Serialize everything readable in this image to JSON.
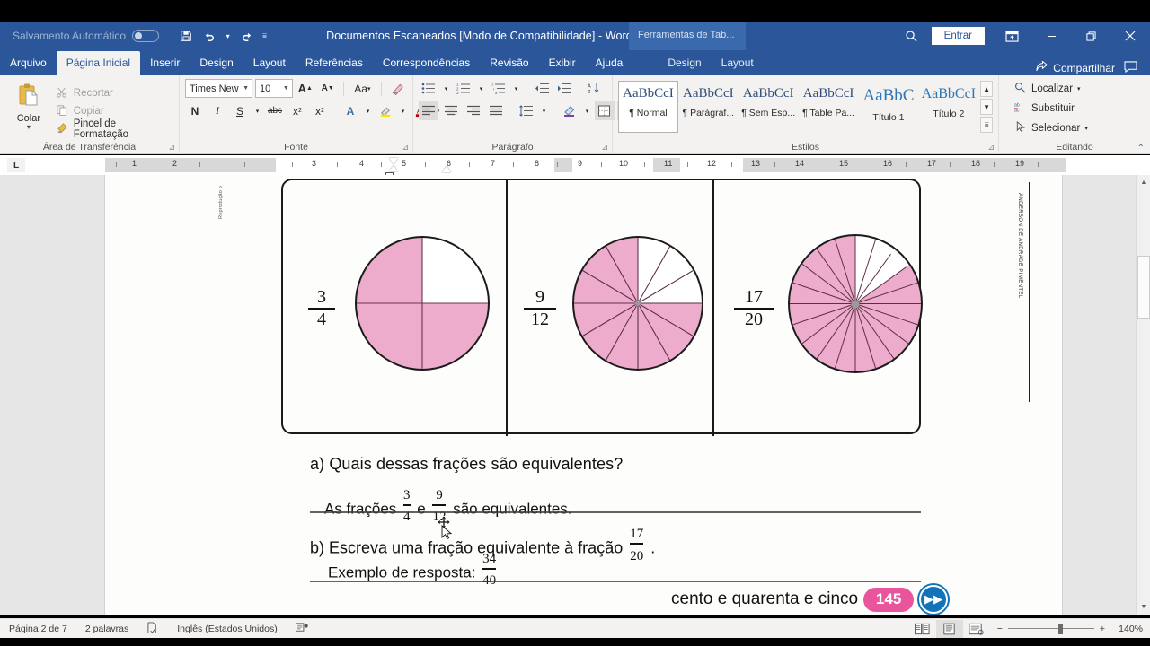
{
  "window": {
    "autosave_label": "Salvamento Automático",
    "doc_title": "Documentos Escaneados [Modo de Compatibilidade]  -  Word",
    "context_tools": "Ferramentas de Tab...",
    "sign_in": "Entrar",
    "share": "Compartilhar",
    "accent": "#2b579a"
  },
  "quick_access": [
    {
      "name": "save-icon",
      "glyph": "ὋE"
    },
    {
      "name": "undo-icon",
      "glyph": "↶"
    },
    {
      "name": "redo-icon",
      "glyph": "↷"
    },
    {
      "name": "customize-qat-icon",
      "glyph": "≡"
    }
  ],
  "tabs": [
    {
      "label": "Arquivo",
      "active": false
    },
    {
      "label": "Página Inicial",
      "active": true
    },
    {
      "label": "Inserir",
      "active": false
    },
    {
      "label": "Design",
      "active": false
    },
    {
      "label": "Layout",
      "active": false
    },
    {
      "label": "Referências",
      "active": false
    },
    {
      "label": "Correspondências",
      "active": false
    },
    {
      "label": "Revisão",
      "active": false
    },
    {
      "label": "Exibir",
      "active": false
    },
    {
      "label": "Ajuda",
      "active": false
    }
  ],
  "context_tabs": [
    {
      "label": "Design"
    },
    {
      "label": "Layout"
    }
  ],
  "ribbon": {
    "clipboard": {
      "group_name": "Área de Transferência",
      "paste_label": "Colar",
      "items": [
        {
          "label": "Recortar",
          "icon": "scissors-icon",
          "enabled": false
        },
        {
          "label": "Copiar",
          "icon": "copy-icon",
          "enabled": false
        },
        {
          "label": "Pincel de Formatação",
          "icon": "format-painter-icon",
          "enabled": true
        }
      ]
    },
    "font": {
      "group_name": "Fonte",
      "font_name": "Times New R",
      "font_size": "10",
      "buttons": [
        {
          "name": "grow-font",
          "glyph": "A"
        },
        {
          "name": "shrink-font",
          "glyph": "A"
        },
        {
          "name": "change-case",
          "glyph": "Aa"
        },
        {
          "name": "clear-formatting",
          "glyph": "⌫"
        },
        {
          "name": "bold",
          "glyph": "N"
        },
        {
          "name": "italic",
          "glyph": "I"
        },
        {
          "name": "underline",
          "glyph": "S"
        },
        {
          "name": "strikethrough",
          "glyph": "abc"
        },
        {
          "name": "subscript",
          "glyph": "x₂"
        },
        {
          "name": "superscript",
          "glyph": "x²"
        },
        {
          "name": "text-effects",
          "glyph": "A"
        },
        {
          "name": "text-highlight",
          "glyph": "ab"
        },
        {
          "name": "font-color",
          "glyph": "A"
        }
      ]
    },
    "paragraph": {
      "group_name": "Parágrafo"
    },
    "styles": {
      "group_name": "Estilos",
      "items": [
        {
          "preview": "AaBbCcI",
          "name": "¶ Normal",
          "selected": true,
          "size": "normal"
        },
        {
          "preview": "AaBbCcI",
          "name": "¶ Parágraf...",
          "selected": false,
          "size": "normal"
        },
        {
          "preview": "AaBbCcI",
          "name": "¶ Sem Esp...",
          "selected": false,
          "size": "normal"
        },
        {
          "preview": "AaBbCcI",
          "name": "¶ Table Pa...",
          "selected": false,
          "size": "normal"
        },
        {
          "preview": "AaBbC",
          "name": "Título 1",
          "selected": false,
          "size": "t1"
        },
        {
          "preview": "AaBbCcI",
          "name": "Título 2",
          "selected": false,
          "size": "t2"
        }
      ]
    },
    "editing": {
      "group_name": "Editando",
      "items": [
        {
          "label": "Localizar",
          "icon": "search-icon",
          "dropdown": true
        },
        {
          "label": "Substituir",
          "icon": "replace-icon",
          "dropdown": false
        },
        {
          "label": "Selecionar",
          "icon": "select-icon",
          "dropdown": true
        }
      ]
    }
  },
  "ruler": {
    "tab_stop_marker": "L",
    "numbers": [
      "1",
      "2",
      "3",
      "4",
      "5",
      "6",
      "7",
      "8",
      "9",
      "10",
      "11",
      "12",
      "13",
      "14",
      "15",
      "16",
      "17",
      "18",
      "19"
    ]
  },
  "document": {
    "vertical_left_credit": "Reprodução p",
    "vertical_right_credit": "ANDERSON DE ANDRADE PIMENTEL",
    "figures": [
      {
        "fraction_num": "3",
        "fraction_den": "4",
        "slices": 4,
        "shaded": 3
      },
      {
        "fraction_num": "9",
        "fraction_den": "12",
        "slices": 12,
        "shaded": 9
      },
      {
        "fraction_num": "17",
        "fraction_den": "20",
        "slices": 20,
        "shaded": 17
      }
    ],
    "question_a": {
      "marker": "a)",
      "text": "Quais dessas frações são equivalentes?",
      "answer_prefix": "As frações",
      "answer_frac1_num": "3",
      "answer_frac1_den": "4",
      "answer_conj": "e",
      "answer_frac2_num": "9",
      "answer_frac2_den": "12",
      "answer_suffix": "são equivalentes."
    },
    "question_b": {
      "marker": "b)",
      "text": "Escreva uma fração equivalente à fração",
      "frac_num": "17",
      "frac_den": "20",
      "period": ".",
      "answer_prefix": "Exemplo de resposta:",
      "answer_num": "34",
      "answer_den": "40"
    },
    "footer": {
      "words": "cento e quarenta e cinco",
      "page_number": "145",
      "badge_color": "#e8559c",
      "arrow_color": "#1273b8"
    }
  },
  "status_bar": {
    "page_info": "Página 2 de 7",
    "word_count": "2 palavras",
    "proofing_icon": "proofing-icon",
    "language": "Inglês (Estados Unidos)",
    "accessibility_icon": "accessibility-icon",
    "views": [
      {
        "name": "read-mode-view",
        "glyph": "▤"
      },
      {
        "name": "print-layout-view",
        "glyph": "▦",
        "active": true
      },
      {
        "name": "web-layout-view",
        "glyph": "▥"
      }
    ],
    "zoom_out": "−",
    "zoom_in": "+",
    "zoom_level": "140%"
  }
}
